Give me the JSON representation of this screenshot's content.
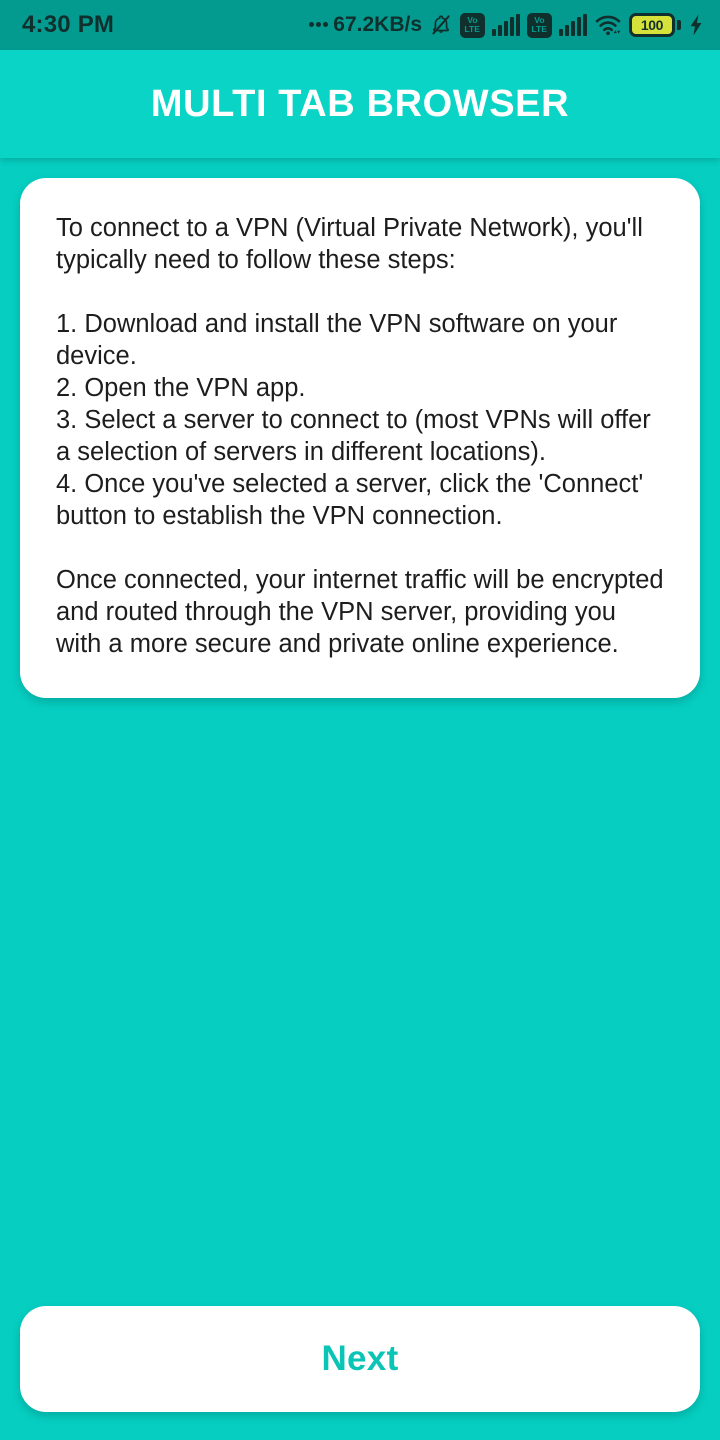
{
  "status_bar": {
    "clock": "4:30 PM",
    "network_speed": "67.2KB/s",
    "speed_prefix_icon": "ellipsis-icon",
    "notifications_silenced_icon": "bell-muted-icon",
    "sim1": {
      "volte_top": "Vo",
      "volte_bottom": "LTE",
      "signal_icon": "signal-bars-icon",
      "bars": 5
    },
    "sim2": {
      "volte_top": "Vo",
      "volte_bottom": "LTE",
      "signal_icon": "signal-bars-icon",
      "bars": 5
    },
    "wifi_icon": "wifi-icon",
    "battery": {
      "level": "100",
      "charging_icon": "lightning-bolt-icon"
    }
  },
  "app_bar": {
    "title": "MULTI TAB BROWSER"
  },
  "info_card": {
    "body": "To connect to a VPN (Virtual Private Network), you'll typically need to follow these steps:\n\n1. Download and install the VPN software on your device.\n2. Open the VPN app.\n3. Select a server to connect to (most VPNs will offer a selection of servers in different locations).\n4. Once you've selected a server, click the 'Connect' button to establish the VPN connection.\n\nOnce connected, your internet traffic will be encrypted and routed through the VPN server, providing you with a more secure and private online experience."
  },
  "footer": {
    "next_label": "Next"
  },
  "colors": {
    "status_bar_background": "#039b90",
    "app_bar_background": "#0ad4c6",
    "page_background": "#06cfc2",
    "card_background": "#ffffff",
    "accent_text": "#0ac4b5",
    "title_text": "#ffffff",
    "body_text": "#1d1d1d",
    "battery_fill": "#d6e23a"
  }
}
